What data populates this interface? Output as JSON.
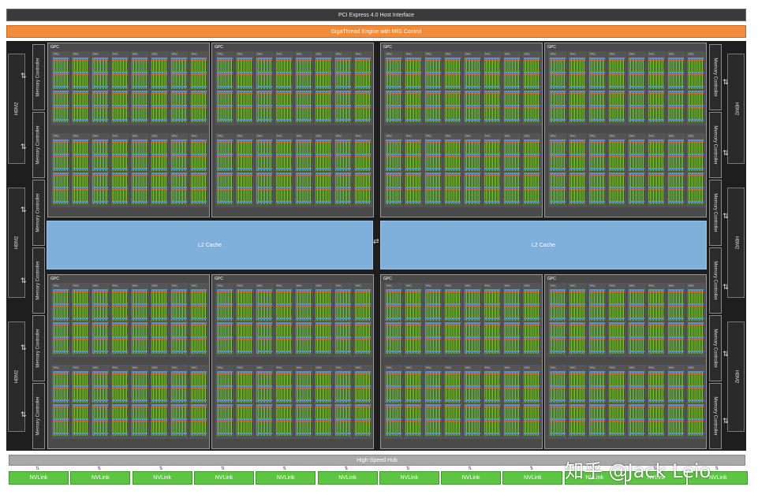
{
  "pcie_label": "PCI Express 4.0 Host Interface",
  "gigathread_label": "GigaThread Engine with MIG Control",
  "hbm_label": "HBM2",
  "memory_controller_label": "Memory Controller",
  "gpc_label": "GPC",
  "tpc_label": "TPC",
  "l2_cache_label": "L2 Cache",
  "high_speed_hub_label": "High-Speed Hub",
  "nvlink_label": "NVLink",
  "nvlink_count": 12,
  "gpc_count": 8,
  "watermark": "知乎 @Jack Leio",
  "colors": {
    "pcie": "#3a3a3a",
    "gigathread": "#f08c3c",
    "sm_green": "#6fa83a",
    "l2_cache": "#7fb0dc",
    "nvlink": "#5ec444",
    "hub": "#a8a8a8"
  }
}
